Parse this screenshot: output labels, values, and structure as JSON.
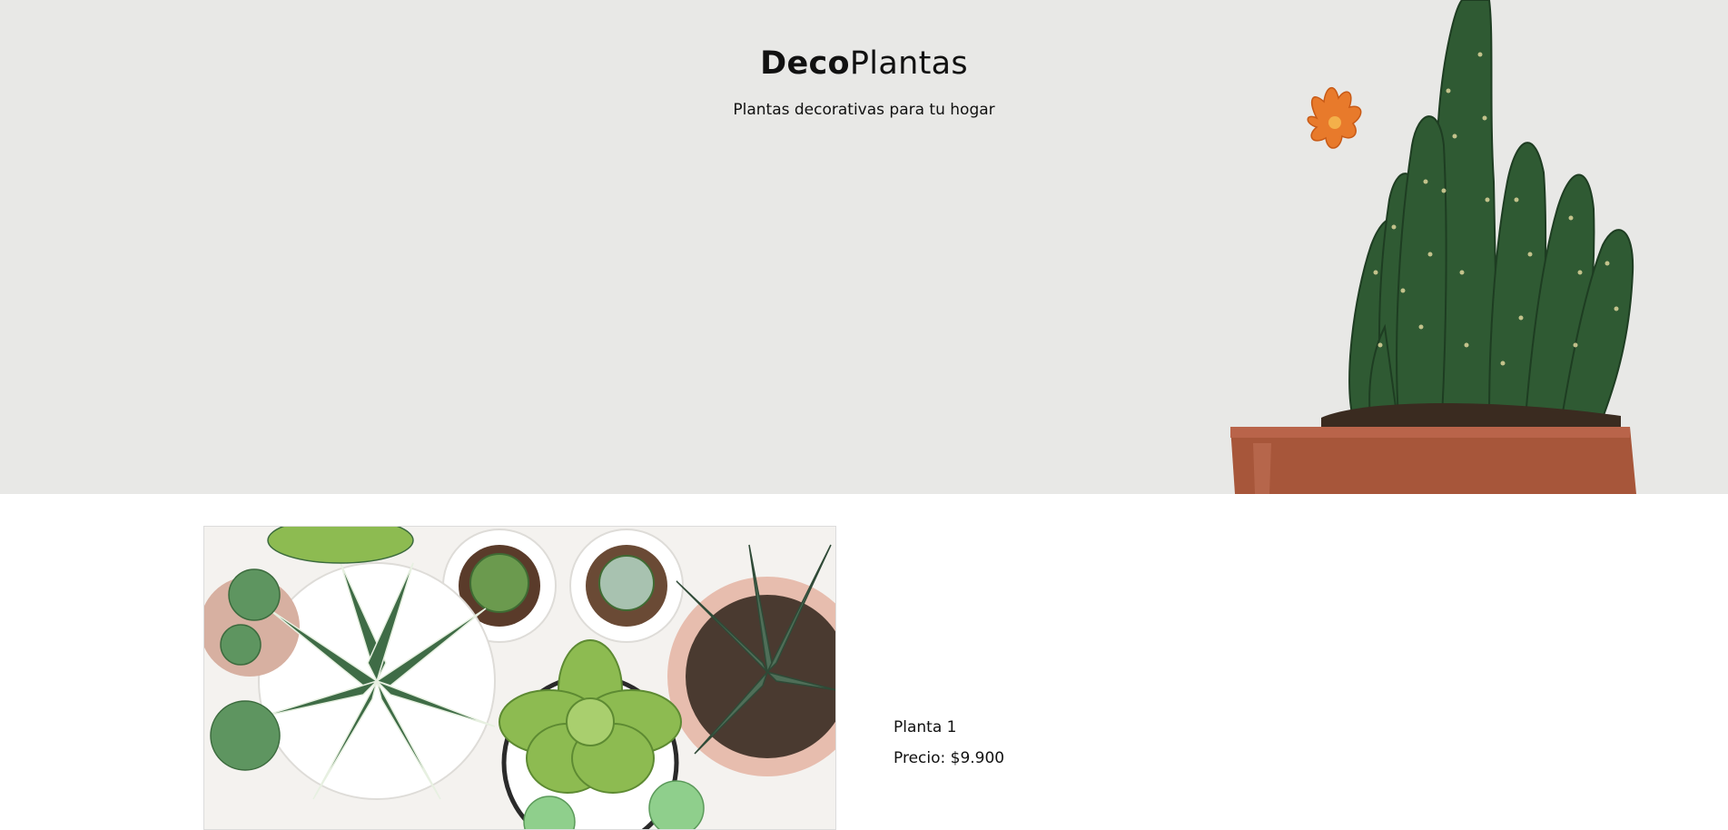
{
  "header": {
    "brand_bold": "Deco",
    "brand_light": "Plantas",
    "tagline": "Plantas decorativas para tu hogar"
  },
  "hero": {
    "background_color": "#e8e8e6",
    "image_icon": "potted-cactus-icon"
  },
  "products": [
    {
      "name": "Planta 1",
      "price_label": "Precio: $9.900",
      "image_icon": "succulents-icon"
    }
  ]
}
